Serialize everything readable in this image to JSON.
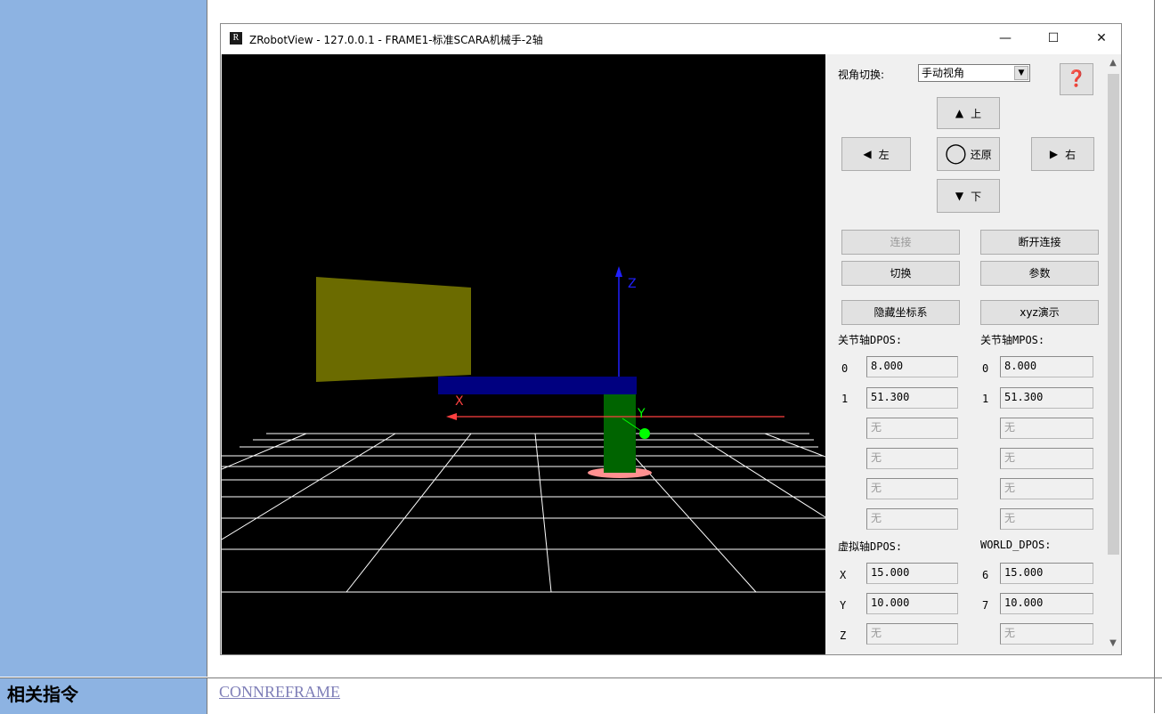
{
  "window": {
    "title": "ZRobotView - 127.0.0.1 - FRAME1-标准SCARA机械手-2轴",
    "app_icon": "R",
    "minimize_glyph": "—",
    "maximize_glyph": "☐",
    "close_glyph": "✕"
  },
  "viewport": {
    "axis_labels": {
      "z": "Z",
      "x": "X",
      "y": "Y"
    },
    "colors": {
      "background": "#000000",
      "grid": "#ffffff",
      "z_axis": "#2020ff",
      "x_axis": "#ff4040",
      "y_marker": "#00ff00",
      "arm_link": "#000080",
      "column": "#006400",
      "base": "#ff9090",
      "block": "#6b6b00"
    }
  },
  "panel": {
    "view_switch_label": "视角切换:",
    "view_select_value": "手动视角",
    "help_glyph": "❓",
    "nav": {
      "up": "上",
      "left": "左",
      "reset": "还原",
      "right": "右",
      "down": "下"
    },
    "buttons": {
      "connect": "连接",
      "disconnect": "断开连接",
      "switch": "切换",
      "params": "参数",
      "hide_coords": "隐藏坐标系",
      "xyz_demo": "xyz演示"
    },
    "joint_dpos": {
      "title": "关节轴DPOS:",
      "rows": [
        {
          "idx": "0",
          "value": "8.000"
        },
        {
          "idx": "1",
          "value": "51.300"
        },
        {
          "idx": "",
          "value": "无"
        },
        {
          "idx": "",
          "value": "无"
        },
        {
          "idx": "",
          "value": "无"
        },
        {
          "idx": "",
          "value": "无"
        }
      ]
    },
    "joint_mpos": {
      "title": "关节轴MPOS:",
      "rows": [
        {
          "idx": "0",
          "value": "8.000"
        },
        {
          "idx": "1",
          "value": "51.300"
        },
        {
          "idx": "",
          "value": "无"
        },
        {
          "idx": "",
          "value": "无"
        },
        {
          "idx": "",
          "value": "无"
        },
        {
          "idx": "",
          "value": "无"
        }
      ]
    },
    "virtual_dpos": {
      "title": "虚拟轴DPOS:",
      "rows": [
        {
          "idx": "X",
          "value": "15.000"
        },
        {
          "idx": "Y",
          "value": "10.000"
        },
        {
          "idx": "Z",
          "value": "无"
        }
      ]
    },
    "world_dpos": {
      "title": "WORLD_DPOS:",
      "rows": [
        {
          "idx": "6",
          "value": "15.000"
        },
        {
          "idx": "7",
          "value": "10.000"
        },
        {
          "idx": "",
          "value": "无"
        }
      ]
    }
  },
  "doc": {
    "related_label": "相关指令",
    "related_link": "CONNREFRAME"
  }
}
